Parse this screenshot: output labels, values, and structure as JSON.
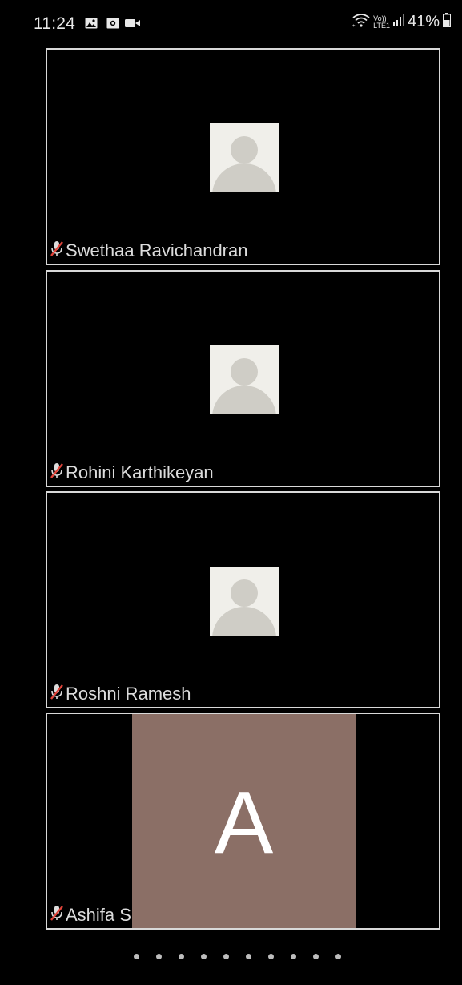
{
  "status_bar": {
    "time": "11:24",
    "left_icons": [
      "gallery-icon",
      "screen-record-icon",
      "video-camera-icon"
    ],
    "right_icons": [
      "wifi-icon",
      "volte-lte-icon",
      "signal-icon",
      "battery-icon"
    ],
    "volte_label": "Vo))",
    "lte_label": "LTE1",
    "battery_percent": "41%"
  },
  "participants": [
    {
      "name": "Swethaa Ravichandran",
      "muted": true,
      "avatar": "default-avatar"
    },
    {
      "name": "Rohini Karthikeyan",
      "muted": true,
      "avatar": "default-avatar"
    },
    {
      "name": "Roshni Ramesh",
      "muted": true,
      "avatar": "default-avatar"
    },
    {
      "name": "Ashifa S",
      "muted": true,
      "avatar": "initial",
      "initial": "A",
      "initial_bg": "#8b6f66"
    }
  ],
  "pagination": {
    "page_count": 10
  },
  "colors": {
    "background": "#000000",
    "tile_border": "#d9d9d9",
    "muted_mic": "#e0443a",
    "initial_bg": "#8b6f66"
  }
}
